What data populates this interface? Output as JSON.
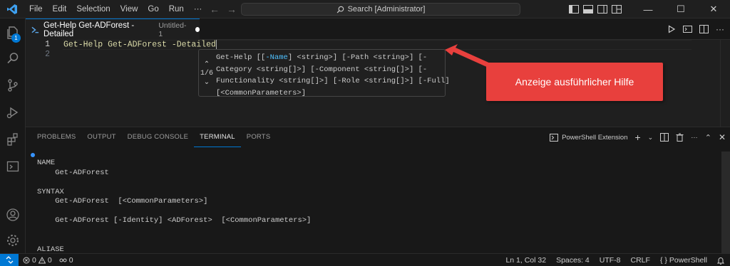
{
  "titlebar": {
    "menu": [
      "File",
      "Edit",
      "Selection",
      "View",
      "Go",
      "Run",
      "···"
    ],
    "search": "Search [Administrator]"
  },
  "tab": {
    "title": "Get-Help Get-ADForest -Detailed",
    "description": "Untitled-1"
  },
  "editor": {
    "line_numbers": [
      "1",
      "2"
    ],
    "line1": "Get-Help Get-ADForest -Detailed"
  },
  "param_hint": {
    "counter": "1/6",
    "line1_pre": "Get-Help [[",
    "line1_active": "-Name",
    "line1_post": "] <string>] [-Path <string>] [-",
    "line2": "Category <string[]>] [-Component <string[]>] [-",
    "line3": "Functionality <string[]>] [-Role <string[]>] [-Full]",
    "line4": "[<CommonParameters>]"
  },
  "callout": {
    "text": "Anzeige ausführlicher Hilfe",
    "color": "#e8403d"
  },
  "panel": {
    "tabs": [
      "PROBLEMS",
      "OUTPUT",
      "DEBUG CONSOLE",
      "TERMINAL",
      "PORTS"
    ],
    "active_tab": "TERMINAL",
    "terminal_name": "PowerShell Extension",
    "terminal_lines": [
      "NAME",
      "    Get-ADForest",
      "",
      "SYNTAX",
      "    Get-ADForest  [<CommonParameters>]",
      "",
      "    Get-ADForest [-Identity] <ADForest>  [<CommonParameters>]",
      "",
      "",
      "ALIASE"
    ]
  },
  "statusbar": {
    "errors": "0",
    "warnings": "0",
    "ports": "0",
    "position": "Ln 1, Col 32",
    "spaces": "Spaces: 4",
    "encoding": "UTF-8",
    "eol": "CRLF",
    "language": "PowerShell"
  },
  "activity": {
    "badge": "1"
  },
  "colors": {
    "accent": "#0078d4",
    "background": "#1f1f1f",
    "callout": "#e8403d"
  }
}
